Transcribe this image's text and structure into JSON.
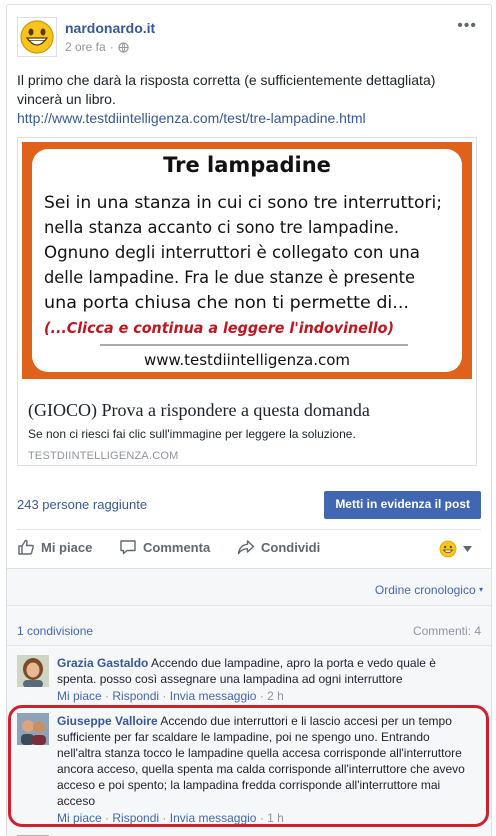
{
  "post": {
    "page_name": "nardonardo.it",
    "time": "2 ore fa",
    "separator": "·",
    "text": "Il primo che darà la risposta corretta (e sufficientemente dettagliata) vincerà un libro.",
    "url": "http://www.testdiintelligenza.com/test/tre-lampadine.html"
  },
  "link_preview": {
    "image": {
      "title": "Tre lampadine",
      "lines": [
        "Sei in una stanza in cui ci sono tre interruttori;",
        "nella stanza accanto ci sono tre lampadine.",
        "Ognuno degli interruttori è collegato con una",
        "delle lampadine. Fra le due stanze è presente",
        "una porta chiusa che non ti permette di..."
      ],
      "cta": "(...Clicca e continua a leggere l'indovinello)",
      "footer_url": "www.testdiintelligenza.com"
    },
    "title": "(GIOCO) Prova a rispondere a questa domanda",
    "description": "Se non ci riesci fai clic sull'immagine per leggere la soluzione.",
    "domain": "TESTDIINTELLIGENZA.COM"
  },
  "stats": {
    "reach": "243 persone raggiunte",
    "boost_label": "Metti in evidenza il post"
  },
  "actions": {
    "like": "Mi piace",
    "comment": "Commenta",
    "share": "Condividi"
  },
  "comments_section": {
    "order": "Ordine cronologico",
    "shares": "1 condivisione",
    "count": "Commenti: 4",
    "comments": [
      {
        "author": "Grazia Gastaldo",
        "text": "Accendo due lampadine, apro la porta e vedo quale è spenta. posso così assegnare una lampadina ad ogni interruttore",
        "like": "Mi piace",
        "reply": "Rispondi",
        "message": "Invia messaggio",
        "time": "2 h"
      },
      {
        "author": "Giuseppe Valloire",
        "text": "Accendo due interruttori e li lascio accesi per un tempo sufficiente per far scaldare le lampadine, poi ne spengo uno. Entrando nell'altra stanza tocco le lampadine quella accesa corrisponde all'interruttore ancora acceso, quella spenta ma calda corrisponde all'interruttore che avevo acceso e poi spento; la lampadina fredda corrisponde all'interruttore mai acceso",
        "like": "Mi piace",
        "reply": "Rispondi",
        "message": "Invia messaggio",
        "time": "1 h"
      }
    ]
  },
  "colors": {
    "link": "#365899",
    "brand_button": "#4267b2",
    "highlight": "#d0202e",
    "image_frame": "#e0621a",
    "cta_red": "#c0161f"
  }
}
